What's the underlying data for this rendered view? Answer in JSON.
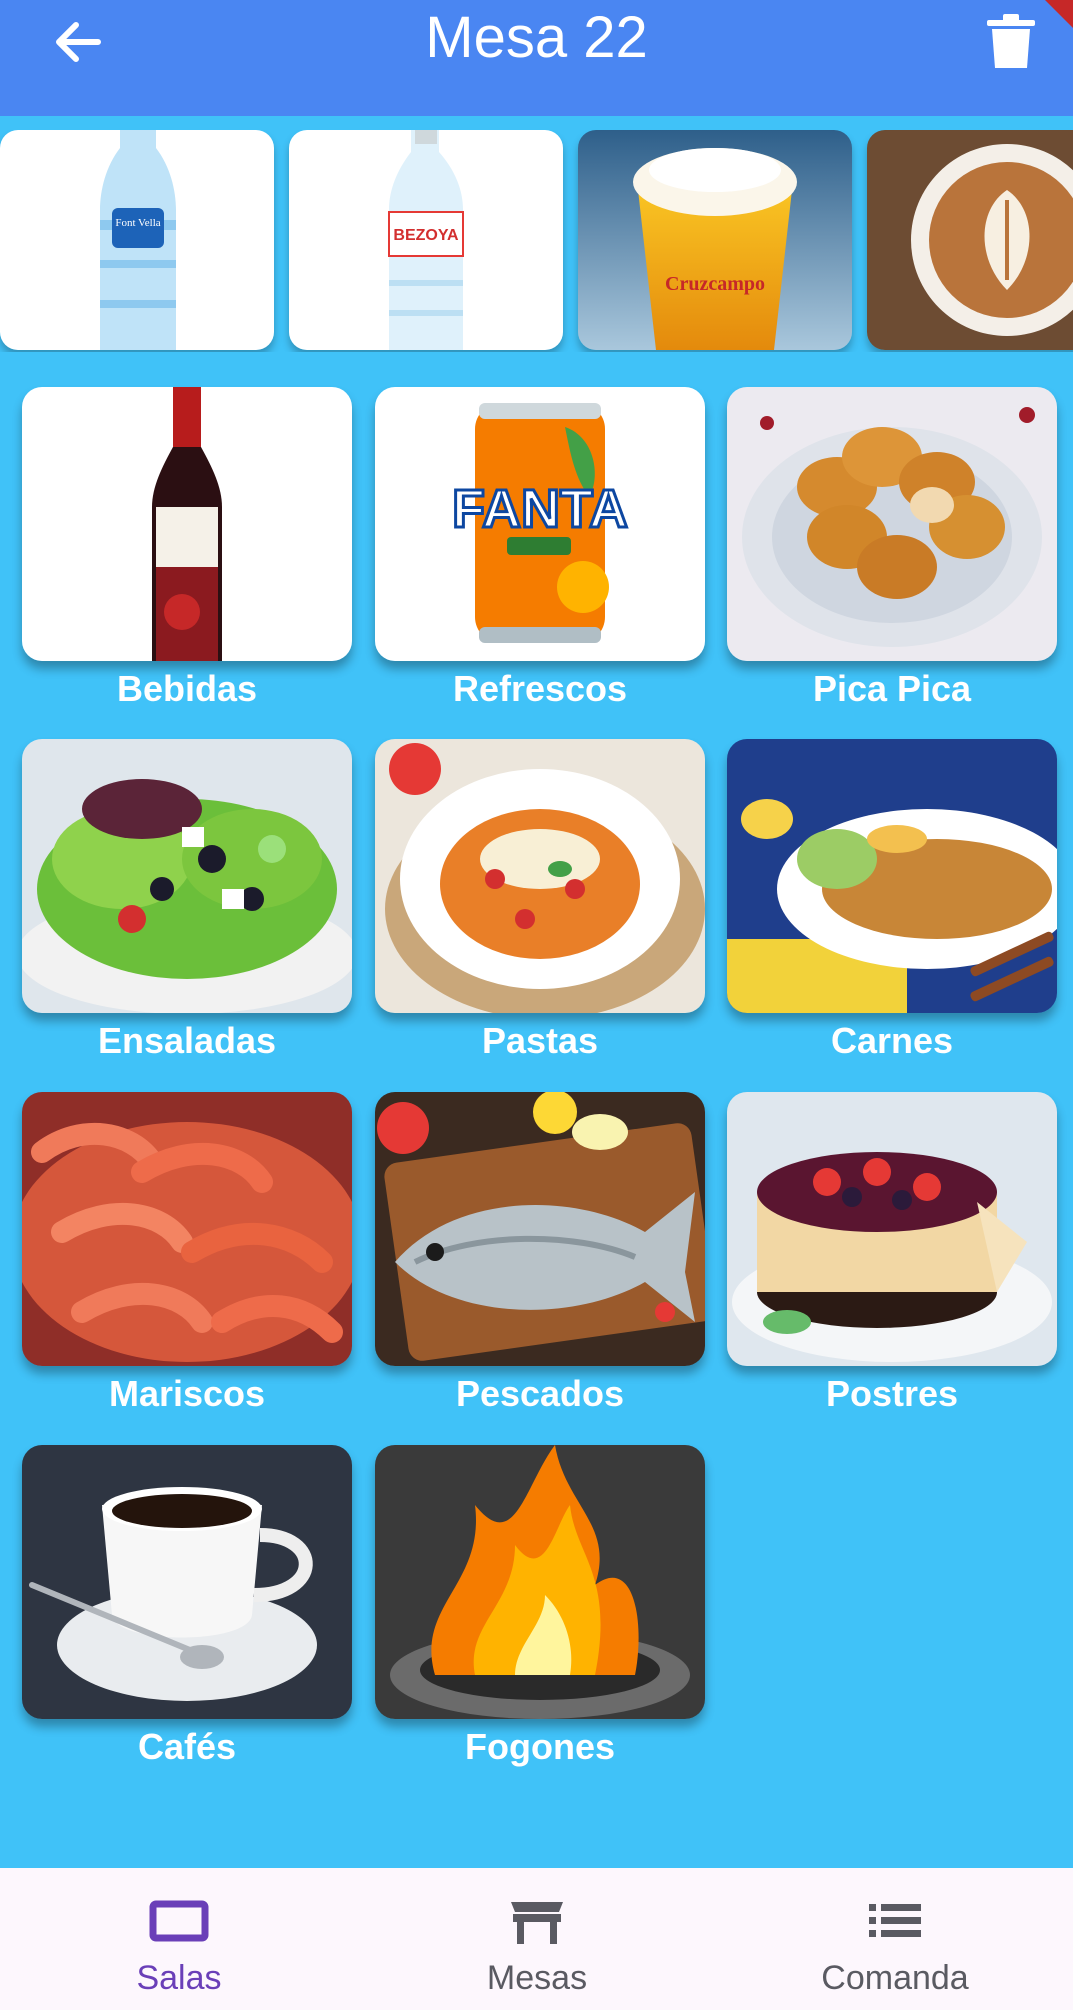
{
  "header": {
    "title": "Mesa 22",
    "back_icon": "arrow-back-icon",
    "delete_icon": "trash-icon",
    "background": "#4a86f2"
  },
  "quick_items": [
    {
      "name": "font-vella-water",
      "brand_text": "Font Vella"
    },
    {
      "name": "bezoya-water",
      "brand_text": "BEZOYA"
    },
    {
      "name": "cruzcampo-beer",
      "brand_text": "Cruzcampo"
    },
    {
      "name": "coffee-latte"
    }
  ],
  "categories": [
    {
      "label": "Bebidas"
    },
    {
      "label": "Refrescos"
    },
    {
      "label": "Pica Pica"
    },
    {
      "label": "Ensaladas"
    },
    {
      "label": "Pastas"
    },
    {
      "label": "Carnes"
    },
    {
      "label": "Mariscos"
    },
    {
      "label": "Pescados"
    },
    {
      "label": "Postres"
    },
    {
      "label": "Cafés"
    },
    {
      "label": "Fogones"
    }
  ],
  "bottom_nav": {
    "items": [
      {
        "label": "Salas",
        "icon": "rectangle-icon",
        "active": true
      },
      {
        "label": "Mesas",
        "icon": "table-icon",
        "active": false
      },
      {
        "label": "Comanda",
        "icon": "list-icon",
        "active": false
      }
    ],
    "active_color": "#6a3fb8"
  },
  "colors": {
    "background": "#40c2f8",
    "label_text": "#ffffff"
  }
}
